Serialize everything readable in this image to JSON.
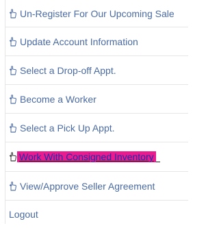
{
  "menu": {
    "items": [
      {
        "label": "Un-Register For Our Upcoming Sale",
        "icon": "hand-pointer-icon"
      },
      {
        "label": "Update Account Information",
        "icon": "hand-pointer-icon"
      },
      {
        "label": "Select a Drop-off Appt.",
        "icon": "hand-pointer-icon"
      },
      {
        "label": "Become a Worker",
        "icon": "hand-pointer-icon"
      },
      {
        "label": "Select a Pick Up Appt.",
        "icon": "hand-pointer-icon"
      },
      {
        "label": "Work With Consigned Inventory",
        "icon": "hand-pointer-icon",
        "state": "hover",
        "highlight_color": "#ea1a8f"
      },
      {
        "label": "View/Approve Seller Agreement",
        "icon": "hand-pointer-icon"
      },
      {
        "label": "Logout"
      }
    ],
    "colors": {
      "link": "#4a6aa3",
      "divider": "#e6e6e6",
      "hover_background": "#ea1a8f"
    }
  }
}
